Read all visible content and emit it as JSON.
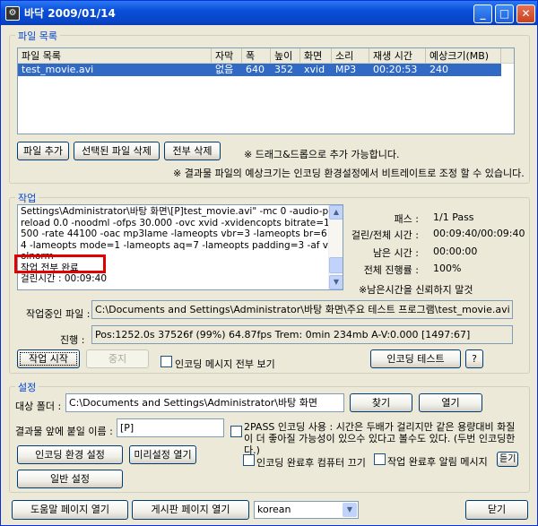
{
  "window": {
    "title": "바닥 2009/01/14",
    "app_icon": "app-icon",
    "minimize": "_",
    "maximize": "□",
    "close": "✕"
  },
  "file_list": {
    "legend": "파일 목록",
    "columns": [
      "파일 목록",
      "자막",
      "폭",
      "높이",
      "화면",
      "소리",
      "재생 시간",
      "예상크기(MB)"
    ],
    "rows": [
      {
        "name": "test_movie.avi",
        "subtitle": "없음",
        "width": "640",
        "height": "352",
        "video": "xvid",
        "audio": "MP3",
        "duration": "00:20:53",
        "size": "240"
      }
    ],
    "add_button": "파일 추가",
    "delete_selected_button": "선택된 파일 삭제",
    "delete_all_button": "전부 삭제",
    "drag_note": "※ 드래그&드롭으로 추가 가능합니다.",
    "size_note": "※ 결과물 파일의 예상크기는 인코딩 환경설정에서 비트레이트로 조정 할 수 있습니다."
  },
  "job": {
    "legend": "작업",
    "log": "Settings\\Administrator\\바탕 화면\\[P]test_movie.avi\" -mc 0 -audio-preload 0.0 -noodml -ofps 30.000 -ovc xvid -xvidencopts bitrate=1500 -rate 44100 -oac mp3lame -lameopts vbr=3 -lameopts br=64 -lameopts mode=1 -lameopts aq=7 -lameopts padding=3 -af volnorm\n작업 전부 완료\n걸린시간 : 00:09:40",
    "pass_label": "패스 :",
    "pass_value": "1/1 Pass",
    "elapsed_label": "걸린/전체 시간 :",
    "elapsed_value": "00:09:40/00:09:40",
    "remaining_label": "남은 시간 :",
    "remaining_value": "00:00:00",
    "progress_label": "전체 진행률 :",
    "progress_value": "100%",
    "remaining_note": "※남은시간을 신뢰하지 말것",
    "current_file_label": "작업중인 파일 :",
    "current_file_value": "C:\\Documents and Settings\\Administrator\\바탕 화면\\주요 테스트 프로그램\\test_movie.avi",
    "status_label": "진행 :",
    "status_value": "Pos:1252.0s  37526f (99%) 64.87fps Trem:   0min 234mb  A-V:0.000 [1497:67]",
    "start_button": "작업 시작",
    "stop_button": "중지",
    "show_all_messages": "인코딩 메시지 전부 보기",
    "encoding_test_button": "인코딩 테스트",
    "help_button": "?"
  },
  "settings": {
    "legend": "설정",
    "target_folder_label": "대상 폴더 :",
    "target_folder_value": "C:\\Documents and Settings\\Administrator\\바탕 화면",
    "browse_button": "찾기",
    "open_button": "열기",
    "prefix_label": "결과물 앞에 붙일 이름 :",
    "prefix_value": "[P]",
    "twopass_text": "2PASS 인코딩 사용 : 시간은 두배가 걸리지만 같은 용량대비 화질이 더 좋아질 가능성이 있으수 있다고 볼수도 있다. (두번 인코딩한다.)",
    "encoding_settings_button": "인코딩 환경 설정",
    "preset_open_button": "미리설정 열기",
    "shutdown_text": "인코딩 완료후 컴퓨터 끄기",
    "notify_text": "작업 완료후 알림 메시지",
    "notify_button": "듣기",
    "general_settings_button": "일반 설정"
  },
  "footer": {
    "help_page_button": "도움말 페이지 열기",
    "board_page_button": "게시판 페이지 열기",
    "language_value": "korean",
    "close_button": "닫기"
  }
}
